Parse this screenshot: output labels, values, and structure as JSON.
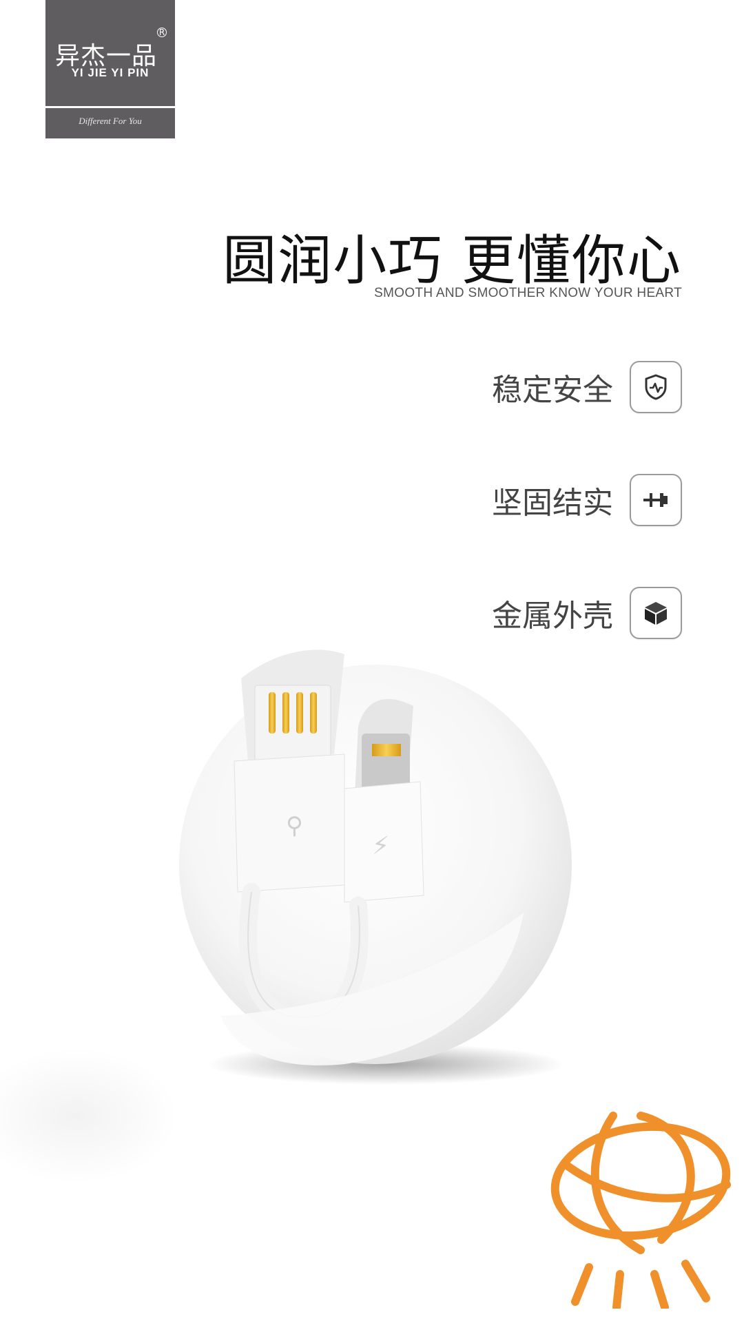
{
  "brand": {
    "chinese_name": "异杰一品",
    "registered_mark": "R",
    "english_name": "YI JIE YI PIN",
    "slogan": "Different For You"
  },
  "headline": "圆润小巧 更懂你心",
  "subheadline": "SMOOTH AND SMOOTHER KNOW YOUR HEART",
  "features": [
    {
      "label": "稳定安全",
      "icon": "shield-pulse-icon"
    },
    {
      "label": "坚固结实",
      "icon": "pin-icon"
    },
    {
      "label": "金属外壳",
      "icon": "metal-box-icon"
    }
  ],
  "colors": {
    "brand_block": "#5f5d5f",
    "accent_orange": "#f0902a",
    "connector_gold": "#e8b830"
  }
}
